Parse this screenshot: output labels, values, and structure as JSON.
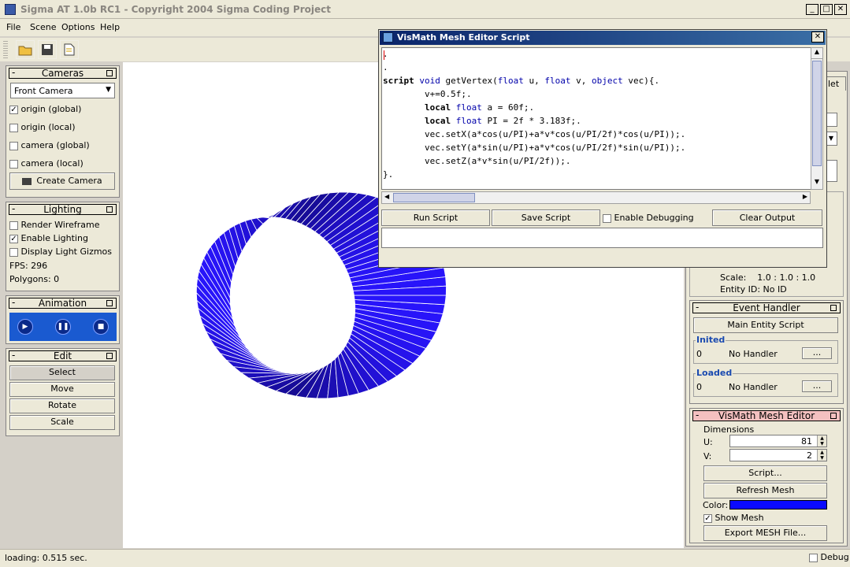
{
  "app": {
    "title": "Sigma AT 1.0b RC1 - Copyright 2004 Sigma Coding Project"
  },
  "menu": [
    "File",
    "Scene",
    "Options",
    "Help"
  ],
  "cameras": {
    "title": "Cameras",
    "select_value": "Front Camera",
    "items": [
      "origin (global)",
      "origin (local)",
      "camera (global)",
      "camera (local)"
    ],
    "create_label": "Create Camera"
  },
  "lighting": {
    "title": "Lighting",
    "render_wireframe": "Render Wireframe",
    "enable_lighting": "Enable Lighting",
    "display_gizmos": "Display Light Gizmos",
    "fps": "FPS: 296",
    "polygons": "Polygons: 0"
  },
  "animation": {
    "title": "Animation"
  },
  "edit": {
    "title": "Edit",
    "buttons": [
      "Select",
      "Move",
      "Rotate",
      "Scale"
    ]
  },
  "script_window": {
    "title": "VisMath Mesh Editor Script",
    "code_lines": [
      ".",
      ".",
      "script void getVertex(float u, float v, object vec){.",
      "        v+=0.5f;.",
      "        local float a = 60f;.",
      "        local float PI = 2f * 3.183f;.",
      "        vec.setX(a*cos(u/PI)+a*v*cos(u/PI/2f)*cos(u/PI));.",
      "        vec.setY(a*sin(u/PI)+a*v*cos(u/PI/2f)*sin(u/PI));.",
      "        vec.setZ(a*v*sin(u/PI/2f));.",
      "}.",
      "."
    ],
    "run_label": "Run Script",
    "save_label": "Save Script",
    "debug_label": "Enable Debugging",
    "clear_label": "Clear Output"
  },
  "right_panel": {
    "tab_label": "let",
    "scale": "Scale:    1.0 : 1.0 : 1.0",
    "entity_id": "Entity ID: No ID",
    "event_handler_title": "Event Handler",
    "main_entity_script": "Main Entity Script",
    "inited_label": "Inited",
    "inited_count": "0",
    "inited_handler": "No Handler",
    "loaded_label": "Loaded",
    "loaded_count": "0",
    "loaded_handler": "No Handler",
    "ellipsis": "...",
    "mesh_editor_title": "VisMath Mesh Editor",
    "dimensions_label": "Dimensions",
    "u_label": "U:",
    "u_value": "81",
    "v_label": "V:",
    "v_value": "2",
    "script_btn": "Script...",
    "refresh_btn": "Refresh Mesh",
    "color_label": "Color:",
    "color_value": "#0a0aff",
    "show_mesh": "Show Mesh",
    "export_btn": "Export MESH File..."
  },
  "status": {
    "text": "loading: 0.515 sec.",
    "debug_label": "Debug"
  },
  "colors": {
    "mesh": "#3a1ee0",
    "mesh_dark": "#1a0a8a",
    "accent": "#0a246a"
  }
}
